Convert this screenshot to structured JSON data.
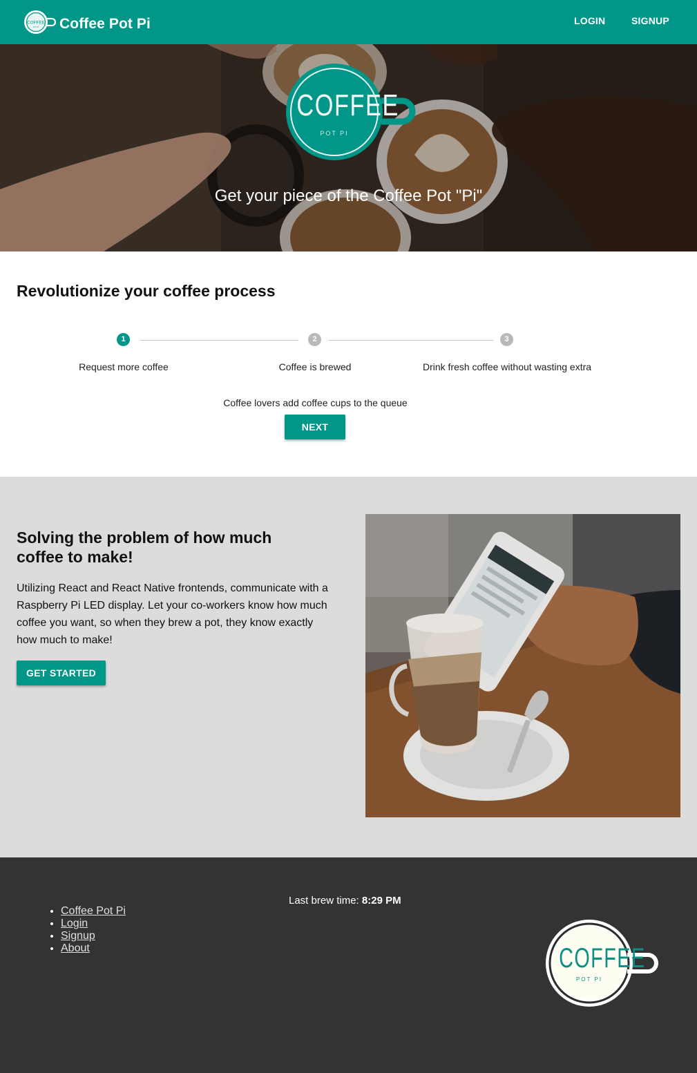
{
  "app_bar": {
    "brand_title": "Coffee Pot Pi",
    "logo_icon": "coffee-cup-logo",
    "nav": {
      "login": "LOGIN",
      "signup": "SIGNUP"
    },
    "color": "#009688"
  },
  "hero": {
    "logo_word": "COFFEE",
    "logo_sub": "POT PI",
    "tagline": "Get your piece of the Coffee Pot \"Pi\""
  },
  "process": {
    "title": "Revolutionize your coffee process",
    "steps": [
      {
        "number": "1",
        "label": "Request more coffee",
        "state": "active"
      },
      {
        "number": "2",
        "label": "Coffee is brewed",
        "state": "inactive"
      },
      {
        "number": "3",
        "label": "Drink fresh coffee without wasting extra",
        "state": "inactive"
      }
    ],
    "current_description": "Coffee lovers add coffee cups to the queue",
    "next_label": "NEXT"
  },
  "info": {
    "title": "Solving the problem of how much coffee to make!",
    "body": "Utilizing React and React Native frontends, communicate with a Raspberry Pi LED display. Let your co-workers know how much coffee you want, so when they brew a pot, they know exactly how much to make!",
    "cta_label": "GET STARTED"
  },
  "footer": {
    "links": [
      "Coffee Pot Pi",
      "Login",
      "Signup",
      "About"
    ],
    "brew_label": "Last brew time:",
    "brew_time": "8:29 PM",
    "logo_word": "COFFEE",
    "logo_sub": "POT PI"
  },
  "colors": {
    "primary": "#009688",
    "inactive_step": "#b9b9b9",
    "section_gray": "#dcdcdc",
    "footer_bg": "#333333"
  }
}
